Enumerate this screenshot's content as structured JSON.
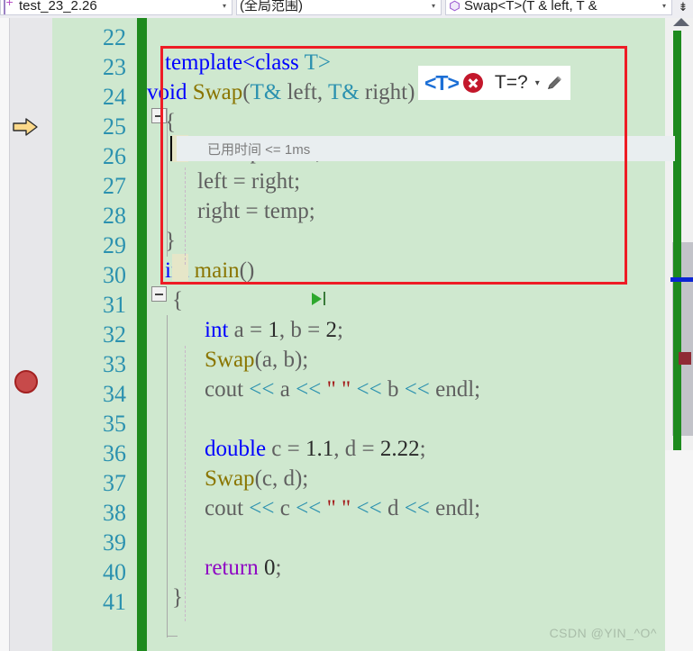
{
  "navbar": {
    "project_combo": {
      "icon": "file-icon",
      "value": "test_23_2.26",
      "arrow": "▾"
    },
    "scope_combo": {
      "value": "(全局范围)",
      "arrow": "▾"
    },
    "member_combo": {
      "icon": "method-hexagon-icon",
      "value": "Swap<T>(T & left, T &",
      "arrow": "▾"
    },
    "toolbar_button": "⇟"
  },
  "gutter": {
    "line_numbers": [
      22,
      23,
      24,
      25,
      26,
      27,
      28,
      29,
      30,
      31,
      32,
      33,
      34,
      35,
      36,
      37,
      38,
      39,
      40,
      41
    ],
    "current_statement_line": 25,
    "breakpoint_line": 33
  },
  "codelens": {
    "text": "已用时间 <= 1ms"
  },
  "template_param_widget": {
    "label": "<T>",
    "error_icon": "error-circle-x-icon",
    "value": "T=?",
    "dropdown_arrow": "▾",
    "edit_icon": "pencil-icon"
  },
  "code": {
    "lines": [
      {
        "n": 22,
        "segments": []
      },
      {
        "n": 23,
        "segments": [
          {
            "t": "template",
            "c": "tk-key"
          },
          {
            "t": "<",
            "c": "tk-key"
          },
          {
            "t": "class",
            "c": "tk-key"
          },
          {
            "t": " T>",
            "c": "tk-type"
          }
        ]
      },
      {
        "n": 24,
        "segments": [
          {
            "t": "void ",
            "c": "tk-key"
          },
          {
            "t": "Swap",
            "c": "tk-fn"
          },
          {
            "t": "(",
            "c": "tk-plain"
          },
          {
            "t": "T&",
            "c": "tk-type"
          },
          {
            "t": " left, ",
            "c": "tk-plain"
          },
          {
            "t": "T&",
            "c": "tk-type"
          },
          {
            "t": " right)",
            "c": "tk-plain"
          }
        ]
      },
      {
        "n": 25,
        "segments": [
          {
            "t": "{",
            "c": "tk-plain"
          }
        ]
      },
      {
        "n": 26,
        "segments": [
          {
            "t": "T",
            "c": "tk-type"
          },
          {
            "t": " temp = left;",
            "c": "tk-plain"
          }
        ]
      },
      {
        "n": 27,
        "segments": [
          {
            "t": "left = right;",
            "c": "tk-plain"
          }
        ]
      },
      {
        "n": 28,
        "segments": [
          {
            "t": "right = temp;",
            "c": "tk-plain"
          }
        ]
      },
      {
        "n": 29,
        "segments": [
          {
            "t": "}",
            "c": "tk-plain"
          }
        ]
      },
      {
        "n": 30,
        "segments": [
          {
            "t": "int ",
            "c": "tk-key"
          },
          {
            "t": "main",
            "c": "tk-fn"
          },
          {
            "t": "()",
            "c": "tk-plain"
          }
        ]
      },
      {
        "n": 31,
        "segments": [
          {
            "t": "{",
            "c": "tk-plain"
          }
        ]
      },
      {
        "n": 32,
        "segments": [
          {
            "t": "int ",
            "c": "tk-key"
          },
          {
            "t": "a = ",
            "c": "tk-plain"
          },
          {
            "t": "1",
            "c": "tk-dark"
          },
          {
            "t": ", b = ",
            "c": "tk-plain"
          },
          {
            "t": "2",
            "c": "tk-dark"
          },
          {
            "t": ";",
            "c": "tk-plain"
          }
        ]
      },
      {
        "n": 33,
        "segments": [
          {
            "t": "Swap",
            "c": "tk-fn"
          },
          {
            "t": "(a, b);",
            "c": "tk-plain"
          }
        ]
      },
      {
        "n": 34,
        "segments": [
          {
            "t": "cout ",
            "c": "tk-plain"
          },
          {
            "t": "<< ",
            "c": "tk-op"
          },
          {
            "t": "a ",
            "c": "tk-plain"
          },
          {
            "t": "<< ",
            "c": "tk-op"
          },
          {
            "t": "\" \"",
            "c": "tk-str"
          },
          {
            "t": " << ",
            "c": "tk-op"
          },
          {
            "t": "b ",
            "c": "tk-plain"
          },
          {
            "t": "<< ",
            "c": "tk-op"
          },
          {
            "t": "endl;",
            "c": "tk-plain"
          }
        ]
      },
      {
        "n": 35,
        "segments": []
      },
      {
        "n": 36,
        "segments": [
          {
            "t": "double ",
            "c": "tk-key"
          },
          {
            "t": "c = ",
            "c": "tk-plain"
          },
          {
            "t": "1.1",
            "c": "tk-dark"
          },
          {
            "t": ", d = ",
            "c": "tk-plain"
          },
          {
            "t": "2.22",
            "c": "tk-dark"
          },
          {
            "t": ";",
            "c": "tk-plain"
          }
        ]
      },
      {
        "n": 37,
        "segments": [
          {
            "t": "Swap",
            "c": "tk-fn"
          },
          {
            "t": "(c, d);",
            "c": "tk-plain"
          }
        ]
      },
      {
        "n": 38,
        "segments": [
          {
            "t": "cout ",
            "c": "tk-plain"
          },
          {
            "t": "<< ",
            "c": "tk-op"
          },
          {
            "t": "c ",
            "c": "tk-plain"
          },
          {
            "t": "<< ",
            "c": "tk-op"
          },
          {
            "t": "\" \"",
            "c": "tk-str"
          },
          {
            "t": " << ",
            "c": "tk-op"
          },
          {
            "t": "d ",
            "c": "tk-plain"
          },
          {
            "t": "<< ",
            "c": "tk-op"
          },
          {
            "t": "endl;",
            "c": "tk-plain"
          }
        ]
      },
      {
        "n": 39,
        "segments": []
      },
      {
        "n": 40,
        "segments": [
          {
            "t": "return ",
            "c": "tk-key2"
          },
          {
            "t": "0",
            "c": "tk-dark"
          },
          {
            "t": ";",
            "c": "tk-plain"
          }
        ]
      },
      {
        "n": 41,
        "segments": [
          {
            "t": "}",
            "c": "tk-plain"
          }
        ]
      }
    ]
  },
  "annotations": {
    "red_highlight_box": "template-function-highlight",
    "run_to_cursor_glyph": "run-to-cursor-icon"
  },
  "watermark": "CSDN @YIN_^O^",
  "colors": {
    "editor_background": "#cfe8cf",
    "change_bar_green": "#1e8a1e",
    "highlight_red": "#ee1c25",
    "breakpoint_red": "#c74a4a",
    "line_number_blue": "#2b91af",
    "keyword_blue": "#0000ff",
    "type_teal": "#2b91af",
    "function_olive": "#8a7500",
    "string_red": "#a31515",
    "return_purple": "#8f08c4"
  }
}
